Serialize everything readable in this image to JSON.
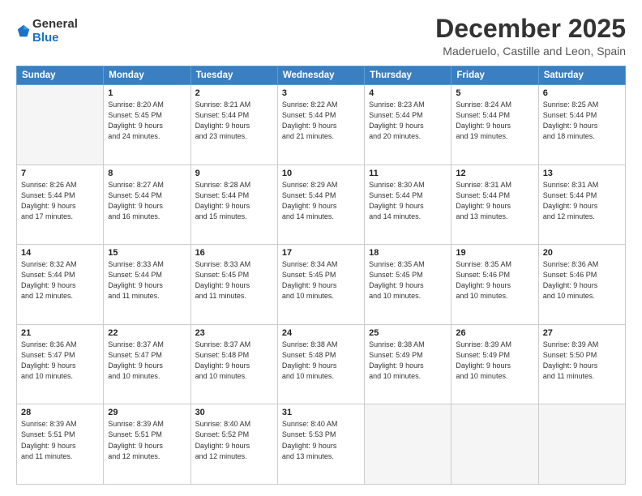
{
  "logo": {
    "general": "General",
    "blue": "Blue"
  },
  "title": "December 2025",
  "subtitle": "Maderuelo, Castille and Leon, Spain",
  "headers": [
    "Sunday",
    "Monday",
    "Tuesday",
    "Wednesday",
    "Thursday",
    "Friday",
    "Saturday"
  ],
  "weeks": [
    [
      {
        "day": "",
        "info": ""
      },
      {
        "day": "1",
        "info": "Sunrise: 8:20 AM\nSunset: 5:45 PM\nDaylight: 9 hours\nand 24 minutes."
      },
      {
        "day": "2",
        "info": "Sunrise: 8:21 AM\nSunset: 5:44 PM\nDaylight: 9 hours\nand 23 minutes."
      },
      {
        "day": "3",
        "info": "Sunrise: 8:22 AM\nSunset: 5:44 PM\nDaylight: 9 hours\nand 21 minutes."
      },
      {
        "day": "4",
        "info": "Sunrise: 8:23 AM\nSunset: 5:44 PM\nDaylight: 9 hours\nand 20 minutes."
      },
      {
        "day": "5",
        "info": "Sunrise: 8:24 AM\nSunset: 5:44 PM\nDaylight: 9 hours\nand 19 minutes."
      },
      {
        "day": "6",
        "info": "Sunrise: 8:25 AM\nSunset: 5:44 PM\nDaylight: 9 hours\nand 18 minutes."
      }
    ],
    [
      {
        "day": "7",
        "info": "Sunrise: 8:26 AM\nSunset: 5:44 PM\nDaylight: 9 hours\nand 17 minutes."
      },
      {
        "day": "8",
        "info": "Sunrise: 8:27 AM\nSunset: 5:44 PM\nDaylight: 9 hours\nand 16 minutes."
      },
      {
        "day": "9",
        "info": "Sunrise: 8:28 AM\nSunset: 5:44 PM\nDaylight: 9 hours\nand 15 minutes."
      },
      {
        "day": "10",
        "info": "Sunrise: 8:29 AM\nSunset: 5:44 PM\nDaylight: 9 hours\nand 14 minutes."
      },
      {
        "day": "11",
        "info": "Sunrise: 8:30 AM\nSunset: 5:44 PM\nDaylight: 9 hours\nand 14 minutes."
      },
      {
        "day": "12",
        "info": "Sunrise: 8:31 AM\nSunset: 5:44 PM\nDaylight: 9 hours\nand 13 minutes."
      },
      {
        "day": "13",
        "info": "Sunrise: 8:31 AM\nSunset: 5:44 PM\nDaylight: 9 hours\nand 12 minutes."
      }
    ],
    [
      {
        "day": "14",
        "info": "Sunrise: 8:32 AM\nSunset: 5:44 PM\nDaylight: 9 hours\nand 12 minutes."
      },
      {
        "day": "15",
        "info": "Sunrise: 8:33 AM\nSunset: 5:44 PM\nDaylight: 9 hours\nand 11 minutes."
      },
      {
        "day": "16",
        "info": "Sunrise: 8:33 AM\nSunset: 5:45 PM\nDaylight: 9 hours\nand 11 minutes."
      },
      {
        "day": "17",
        "info": "Sunrise: 8:34 AM\nSunset: 5:45 PM\nDaylight: 9 hours\nand 10 minutes."
      },
      {
        "day": "18",
        "info": "Sunrise: 8:35 AM\nSunset: 5:45 PM\nDaylight: 9 hours\nand 10 minutes."
      },
      {
        "day": "19",
        "info": "Sunrise: 8:35 AM\nSunset: 5:46 PM\nDaylight: 9 hours\nand 10 minutes."
      },
      {
        "day": "20",
        "info": "Sunrise: 8:36 AM\nSunset: 5:46 PM\nDaylight: 9 hours\nand 10 minutes."
      }
    ],
    [
      {
        "day": "21",
        "info": "Sunrise: 8:36 AM\nSunset: 5:47 PM\nDaylight: 9 hours\nand 10 minutes."
      },
      {
        "day": "22",
        "info": "Sunrise: 8:37 AM\nSunset: 5:47 PM\nDaylight: 9 hours\nand 10 minutes."
      },
      {
        "day": "23",
        "info": "Sunrise: 8:37 AM\nSunset: 5:48 PM\nDaylight: 9 hours\nand 10 minutes."
      },
      {
        "day": "24",
        "info": "Sunrise: 8:38 AM\nSunset: 5:48 PM\nDaylight: 9 hours\nand 10 minutes."
      },
      {
        "day": "25",
        "info": "Sunrise: 8:38 AM\nSunset: 5:49 PM\nDaylight: 9 hours\nand 10 minutes."
      },
      {
        "day": "26",
        "info": "Sunrise: 8:39 AM\nSunset: 5:49 PM\nDaylight: 9 hours\nand 10 minutes."
      },
      {
        "day": "27",
        "info": "Sunrise: 8:39 AM\nSunset: 5:50 PM\nDaylight: 9 hours\nand 11 minutes."
      }
    ],
    [
      {
        "day": "28",
        "info": "Sunrise: 8:39 AM\nSunset: 5:51 PM\nDaylight: 9 hours\nand 11 minutes."
      },
      {
        "day": "29",
        "info": "Sunrise: 8:39 AM\nSunset: 5:51 PM\nDaylight: 9 hours\nand 12 minutes."
      },
      {
        "day": "30",
        "info": "Sunrise: 8:40 AM\nSunset: 5:52 PM\nDaylight: 9 hours\nand 12 minutes."
      },
      {
        "day": "31",
        "info": "Sunrise: 8:40 AM\nSunset: 5:53 PM\nDaylight: 9 hours\nand 13 minutes."
      },
      {
        "day": "",
        "info": ""
      },
      {
        "day": "",
        "info": ""
      },
      {
        "day": "",
        "info": ""
      }
    ]
  ]
}
